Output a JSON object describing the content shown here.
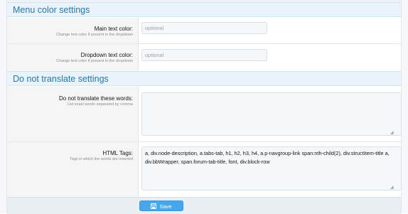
{
  "sections": {
    "menu_color": {
      "title": "Menu color settings"
    },
    "do_not_translate": {
      "title": "Do not translate settings"
    }
  },
  "fields": {
    "main_text_color": {
      "label": "Main text color:",
      "hint": "Change text color if present in the dropdown",
      "value": "",
      "placeholder": "optional"
    },
    "dropdown_text_color": {
      "label": "Dropdown text color:",
      "hint": "Change text color if present in the dropdown",
      "value": "",
      "placeholder": "optional"
    },
    "do_not_translate_words": {
      "label": "Do not translate these words:",
      "hint": "List exact words separated by comma",
      "value": ""
    },
    "html_tags": {
      "label": "HTML Tags:",
      "hint": "Tags in which the words are inserted",
      "value": "a, div.node-description, a.tabs-tab, h1, h2, h3, h4, a.p-navgroup-link span:nth-child(2), div.structItem-title a, div.bbWrapper, span.forum-tab-title, font, div.block-row"
    }
  },
  "footer": {
    "save_label": "Save",
    "save_icon": "save-icon"
  }
}
